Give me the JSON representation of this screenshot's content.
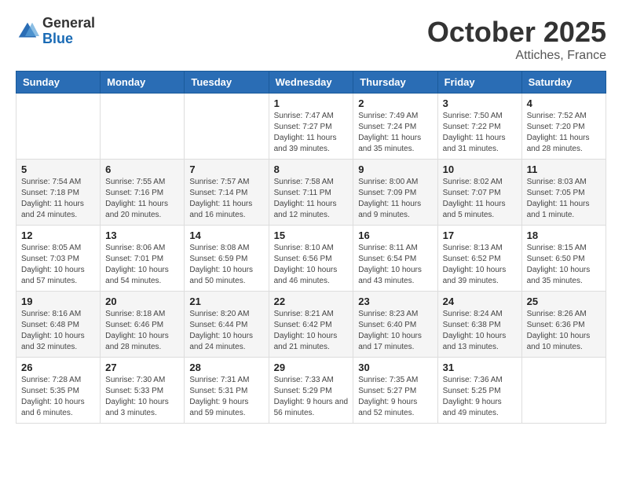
{
  "logo": {
    "general": "General",
    "blue": "Blue"
  },
  "header": {
    "month": "October 2025",
    "location": "Attiches, France"
  },
  "days_of_week": [
    "Sunday",
    "Monday",
    "Tuesday",
    "Wednesday",
    "Thursday",
    "Friday",
    "Saturday"
  ],
  "weeks": [
    [
      {
        "day": "",
        "sunrise": "",
        "sunset": "",
        "daylight": ""
      },
      {
        "day": "",
        "sunrise": "",
        "sunset": "",
        "daylight": ""
      },
      {
        "day": "",
        "sunrise": "",
        "sunset": "",
        "daylight": ""
      },
      {
        "day": "1",
        "sunrise": "Sunrise: 7:47 AM",
        "sunset": "Sunset: 7:27 PM",
        "daylight": "Daylight: 11 hours and 39 minutes."
      },
      {
        "day": "2",
        "sunrise": "Sunrise: 7:49 AM",
        "sunset": "Sunset: 7:24 PM",
        "daylight": "Daylight: 11 hours and 35 minutes."
      },
      {
        "day": "3",
        "sunrise": "Sunrise: 7:50 AM",
        "sunset": "Sunset: 7:22 PM",
        "daylight": "Daylight: 11 hours and 31 minutes."
      },
      {
        "day": "4",
        "sunrise": "Sunrise: 7:52 AM",
        "sunset": "Sunset: 7:20 PM",
        "daylight": "Daylight: 11 hours and 28 minutes."
      }
    ],
    [
      {
        "day": "5",
        "sunrise": "Sunrise: 7:54 AM",
        "sunset": "Sunset: 7:18 PM",
        "daylight": "Daylight: 11 hours and 24 minutes."
      },
      {
        "day": "6",
        "sunrise": "Sunrise: 7:55 AM",
        "sunset": "Sunset: 7:16 PM",
        "daylight": "Daylight: 11 hours and 20 minutes."
      },
      {
        "day": "7",
        "sunrise": "Sunrise: 7:57 AM",
        "sunset": "Sunset: 7:14 PM",
        "daylight": "Daylight: 11 hours and 16 minutes."
      },
      {
        "day": "8",
        "sunrise": "Sunrise: 7:58 AM",
        "sunset": "Sunset: 7:11 PM",
        "daylight": "Daylight: 11 hours and 12 minutes."
      },
      {
        "day": "9",
        "sunrise": "Sunrise: 8:00 AM",
        "sunset": "Sunset: 7:09 PM",
        "daylight": "Daylight: 11 hours and 9 minutes."
      },
      {
        "day": "10",
        "sunrise": "Sunrise: 8:02 AM",
        "sunset": "Sunset: 7:07 PM",
        "daylight": "Daylight: 11 hours and 5 minutes."
      },
      {
        "day": "11",
        "sunrise": "Sunrise: 8:03 AM",
        "sunset": "Sunset: 7:05 PM",
        "daylight": "Daylight: 11 hours and 1 minute."
      }
    ],
    [
      {
        "day": "12",
        "sunrise": "Sunrise: 8:05 AM",
        "sunset": "Sunset: 7:03 PM",
        "daylight": "Daylight: 10 hours and 57 minutes."
      },
      {
        "day": "13",
        "sunrise": "Sunrise: 8:06 AM",
        "sunset": "Sunset: 7:01 PM",
        "daylight": "Daylight: 10 hours and 54 minutes."
      },
      {
        "day": "14",
        "sunrise": "Sunrise: 8:08 AM",
        "sunset": "Sunset: 6:59 PM",
        "daylight": "Daylight: 10 hours and 50 minutes."
      },
      {
        "day": "15",
        "sunrise": "Sunrise: 8:10 AM",
        "sunset": "Sunset: 6:56 PM",
        "daylight": "Daylight: 10 hours and 46 minutes."
      },
      {
        "day": "16",
        "sunrise": "Sunrise: 8:11 AM",
        "sunset": "Sunset: 6:54 PM",
        "daylight": "Daylight: 10 hours and 43 minutes."
      },
      {
        "day": "17",
        "sunrise": "Sunrise: 8:13 AM",
        "sunset": "Sunset: 6:52 PM",
        "daylight": "Daylight: 10 hours and 39 minutes."
      },
      {
        "day": "18",
        "sunrise": "Sunrise: 8:15 AM",
        "sunset": "Sunset: 6:50 PM",
        "daylight": "Daylight: 10 hours and 35 minutes."
      }
    ],
    [
      {
        "day": "19",
        "sunrise": "Sunrise: 8:16 AM",
        "sunset": "Sunset: 6:48 PM",
        "daylight": "Daylight: 10 hours and 32 minutes."
      },
      {
        "day": "20",
        "sunrise": "Sunrise: 8:18 AM",
        "sunset": "Sunset: 6:46 PM",
        "daylight": "Daylight: 10 hours and 28 minutes."
      },
      {
        "day": "21",
        "sunrise": "Sunrise: 8:20 AM",
        "sunset": "Sunset: 6:44 PM",
        "daylight": "Daylight: 10 hours and 24 minutes."
      },
      {
        "day": "22",
        "sunrise": "Sunrise: 8:21 AM",
        "sunset": "Sunset: 6:42 PM",
        "daylight": "Daylight: 10 hours and 21 minutes."
      },
      {
        "day": "23",
        "sunrise": "Sunrise: 8:23 AM",
        "sunset": "Sunset: 6:40 PM",
        "daylight": "Daylight: 10 hours and 17 minutes."
      },
      {
        "day": "24",
        "sunrise": "Sunrise: 8:24 AM",
        "sunset": "Sunset: 6:38 PM",
        "daylight": "Daylight: 10 hours and 13 minutes."
      },
      {
        "day": "25",
        "sunrise": "Sunrise: 8:26 AM",
        "sunset": "Sunset: 6:36 PM",
        "daylight": "Daylight: 10 hours and 10 minutes."
      }
    ],
    [
      {
        "day": "26",
        "sunrise": "Sunrise: 7:28 AM",
        "sunset": "Sunset: 5:35 PM",
        "daylight": "Daylight: 10 hours and 6 minutes."
      },
      {
        "day": "27",
        "sunrise": "Sunrise: 7:30 AM",
        "sunset": "Sunset: 5:33 PM",
        "daylight": "Daylight: 10 hours and 3 minutes."
      },
      {
        "day": "28",
        "sunrise": "Sunrise: 7:31 AM",
        "sunset": "Sunset: 5:31 PM",
        "daylight": "Daylight: 9 hours and 59 minutes."
      },
      {
        "day": "29",
        "sunrise": "Sunrise: 7:33 AM",
        "sunset": "Sunset: 5:29 PM",
        "daylight": "Daylight: 9 hours and 56 minutes."
      },
      {
        "day": "30",
        "sunrise": "Sunrise: 7:35 AM",
        "sunset": "Sunset: 5:27 PM",
        "daylight": "Daylight: 9 hours and 52 minutes."
      },
      {
        "day": "31",
        "sunrise": "Sunrise: 7:36 AM",
        "sunset": "Sunset: 5:25 PM",
        "daylight": "Daylight: 9 hours and 49 minutes."
      },
      {
        "day": "",
        "sunrise": "",
        "sunset": "",
        "daylight": ""
      }
    ]
  ]
}
